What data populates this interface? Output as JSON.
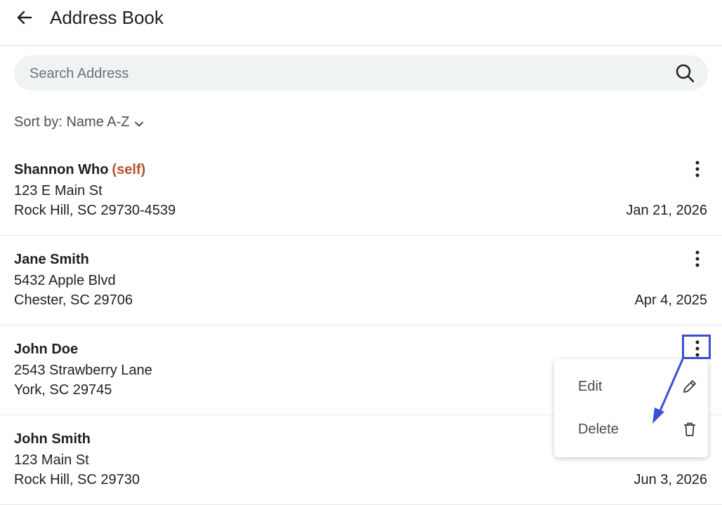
{
  "header": {
    "title": "Address Book",
    "back_icon": "arrow-left-icon"
  },
  "search": {
    "placeholder": "Search Address",
    "value": "",
    "icon": "search-icon"
  },
  "sort": {
    "label": "Sort by: Name A-Z",
    "icon": "chevron-down-icon"
  },
  "contacts": [
    {
      "name": "Shannon Who",
      "tag": "(self)",
      "street": "123 E Main St",
      "city": "Rock Hill, SC 29730-4539",
      "date": "Jan 21, 2026"
    },
    {
      "name": "Jane Smith",
      "tag": "",
      "street": "5432 Apple Blvd",
      "city": "Chester, SC 29706",
      "date": "Apr 4, 2025"
    },
    {
      "name": "John Doe",
      "tag": "",
      "street": "2543 Strawberry Lane",
      "city": "York, SC 29745",
      "date": ""
    },
    {
      "name": "John Smith",
      "tag": "",
      "street": "123 Main St",
      "city": "Rock Hill, SC 29730",
      "date": "Jun 3, 2026"
    }
  ],
  "context_menu": {
    "items": [
      {
        "label": "Edit",
        "icon": "pencil-icon"
      },
      {
        "label": "Delete",
        "icon": "trash-icon"
      }
    ]
  },
  "colors": {
    "accent_self": "#b5532b",
    "annotation": "#3b4fd8",
    "search_bg": "#eff3f3"
  }
}
